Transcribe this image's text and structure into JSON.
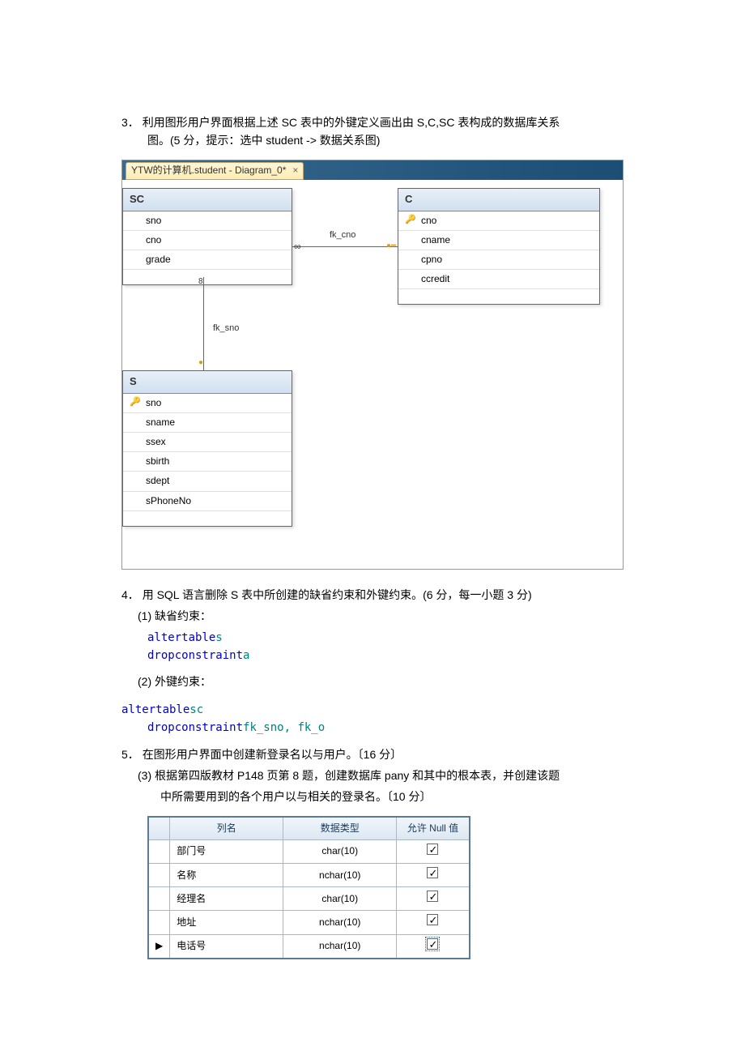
{
  "q3": {
    "num": "3．",
    "text": "利用图形用户界面根据上述 SC 表中的外键定义画出由 S,C,SC 表构成的数据库关系",
    "text2": "图。(5 分，提示：选中 student -> 数据关系图)"
  },
  "diagram": {
    "tab": "YTW的计算机.student - Diagram_0*",
    "tables": {
      "sc": {
        "name": "SC",
        "cols": [
          "sno",
          "cno",
          "grade"
        ]
      },
      "c": {
        "name": "C",
        "cols": [
          "cno",
          "cname",
          "cpno",
          "ccredit"
        ],
        "pk_index": 0
      },
      "s": {
        "name": "S",
        "cols": [
          "sno",
          "sname",
          "ssex",
          "sbirth",
          "sdept",
          "sPhoneNo"
        ],
        "pk_index": 0
      }
    },
    "fk": {
      "cno": "fk_cno",
      "sno": "fk_sno"
    }
  },
  "q4": {
    "num": "4．",
    "text": "用 SQL 语言删除 S 表中所创建的缺省约束和外键约束。(6 分，每一小题 3 分)",
    "s1": "(1) 缺省约束：",
    "code1a_kw": "altertable",
    "code1a_id": "s",
    "code1b_kw": "dropconstraint",
    "code1b_id": "a",
    "s2": "(2) 外键约束：",
    "code2a_kw": "altertable",
    "code2a_id": "sc",
    "code2b_kw": "dropconstraint",
    "code2b_id": "fk_sno, fk_o"
  },
  "q5": {
    "num": "5．",
    "text": "在图形用户界面中创建新登录名以与用户。〔16 分〕",
    "s3": "(3) 根据第四版教材 P148 页第 8 题，创建数据库 pany 和其中的根本表，并创建该题",
    "s3b": "中所需要用到的各个用户以与相关的登录名。〔10 分〕"
  },
  "table2": {
    "headers": [
      "",
      "列名",
      "数据类型",
      "允许 Null 值"
    ],
    "rows": [
      {
        "name": "部门号",
        "type": "char(10)",
        "null": true
      },
      {
        "name": "名称",
        "type": "nchar(10)",
        "null": true
      },
      {
        "name": "经理名",
        "type": "char(10)",
        "null": true
      },
      {
        "name": "地址",
        "type": "nchar(10)",
        "null": true
      },
      {
        "name": "电话号",
        "type": "nchar(10)",
        "null": true,
        "current": true
      }
    ]
  }
}
